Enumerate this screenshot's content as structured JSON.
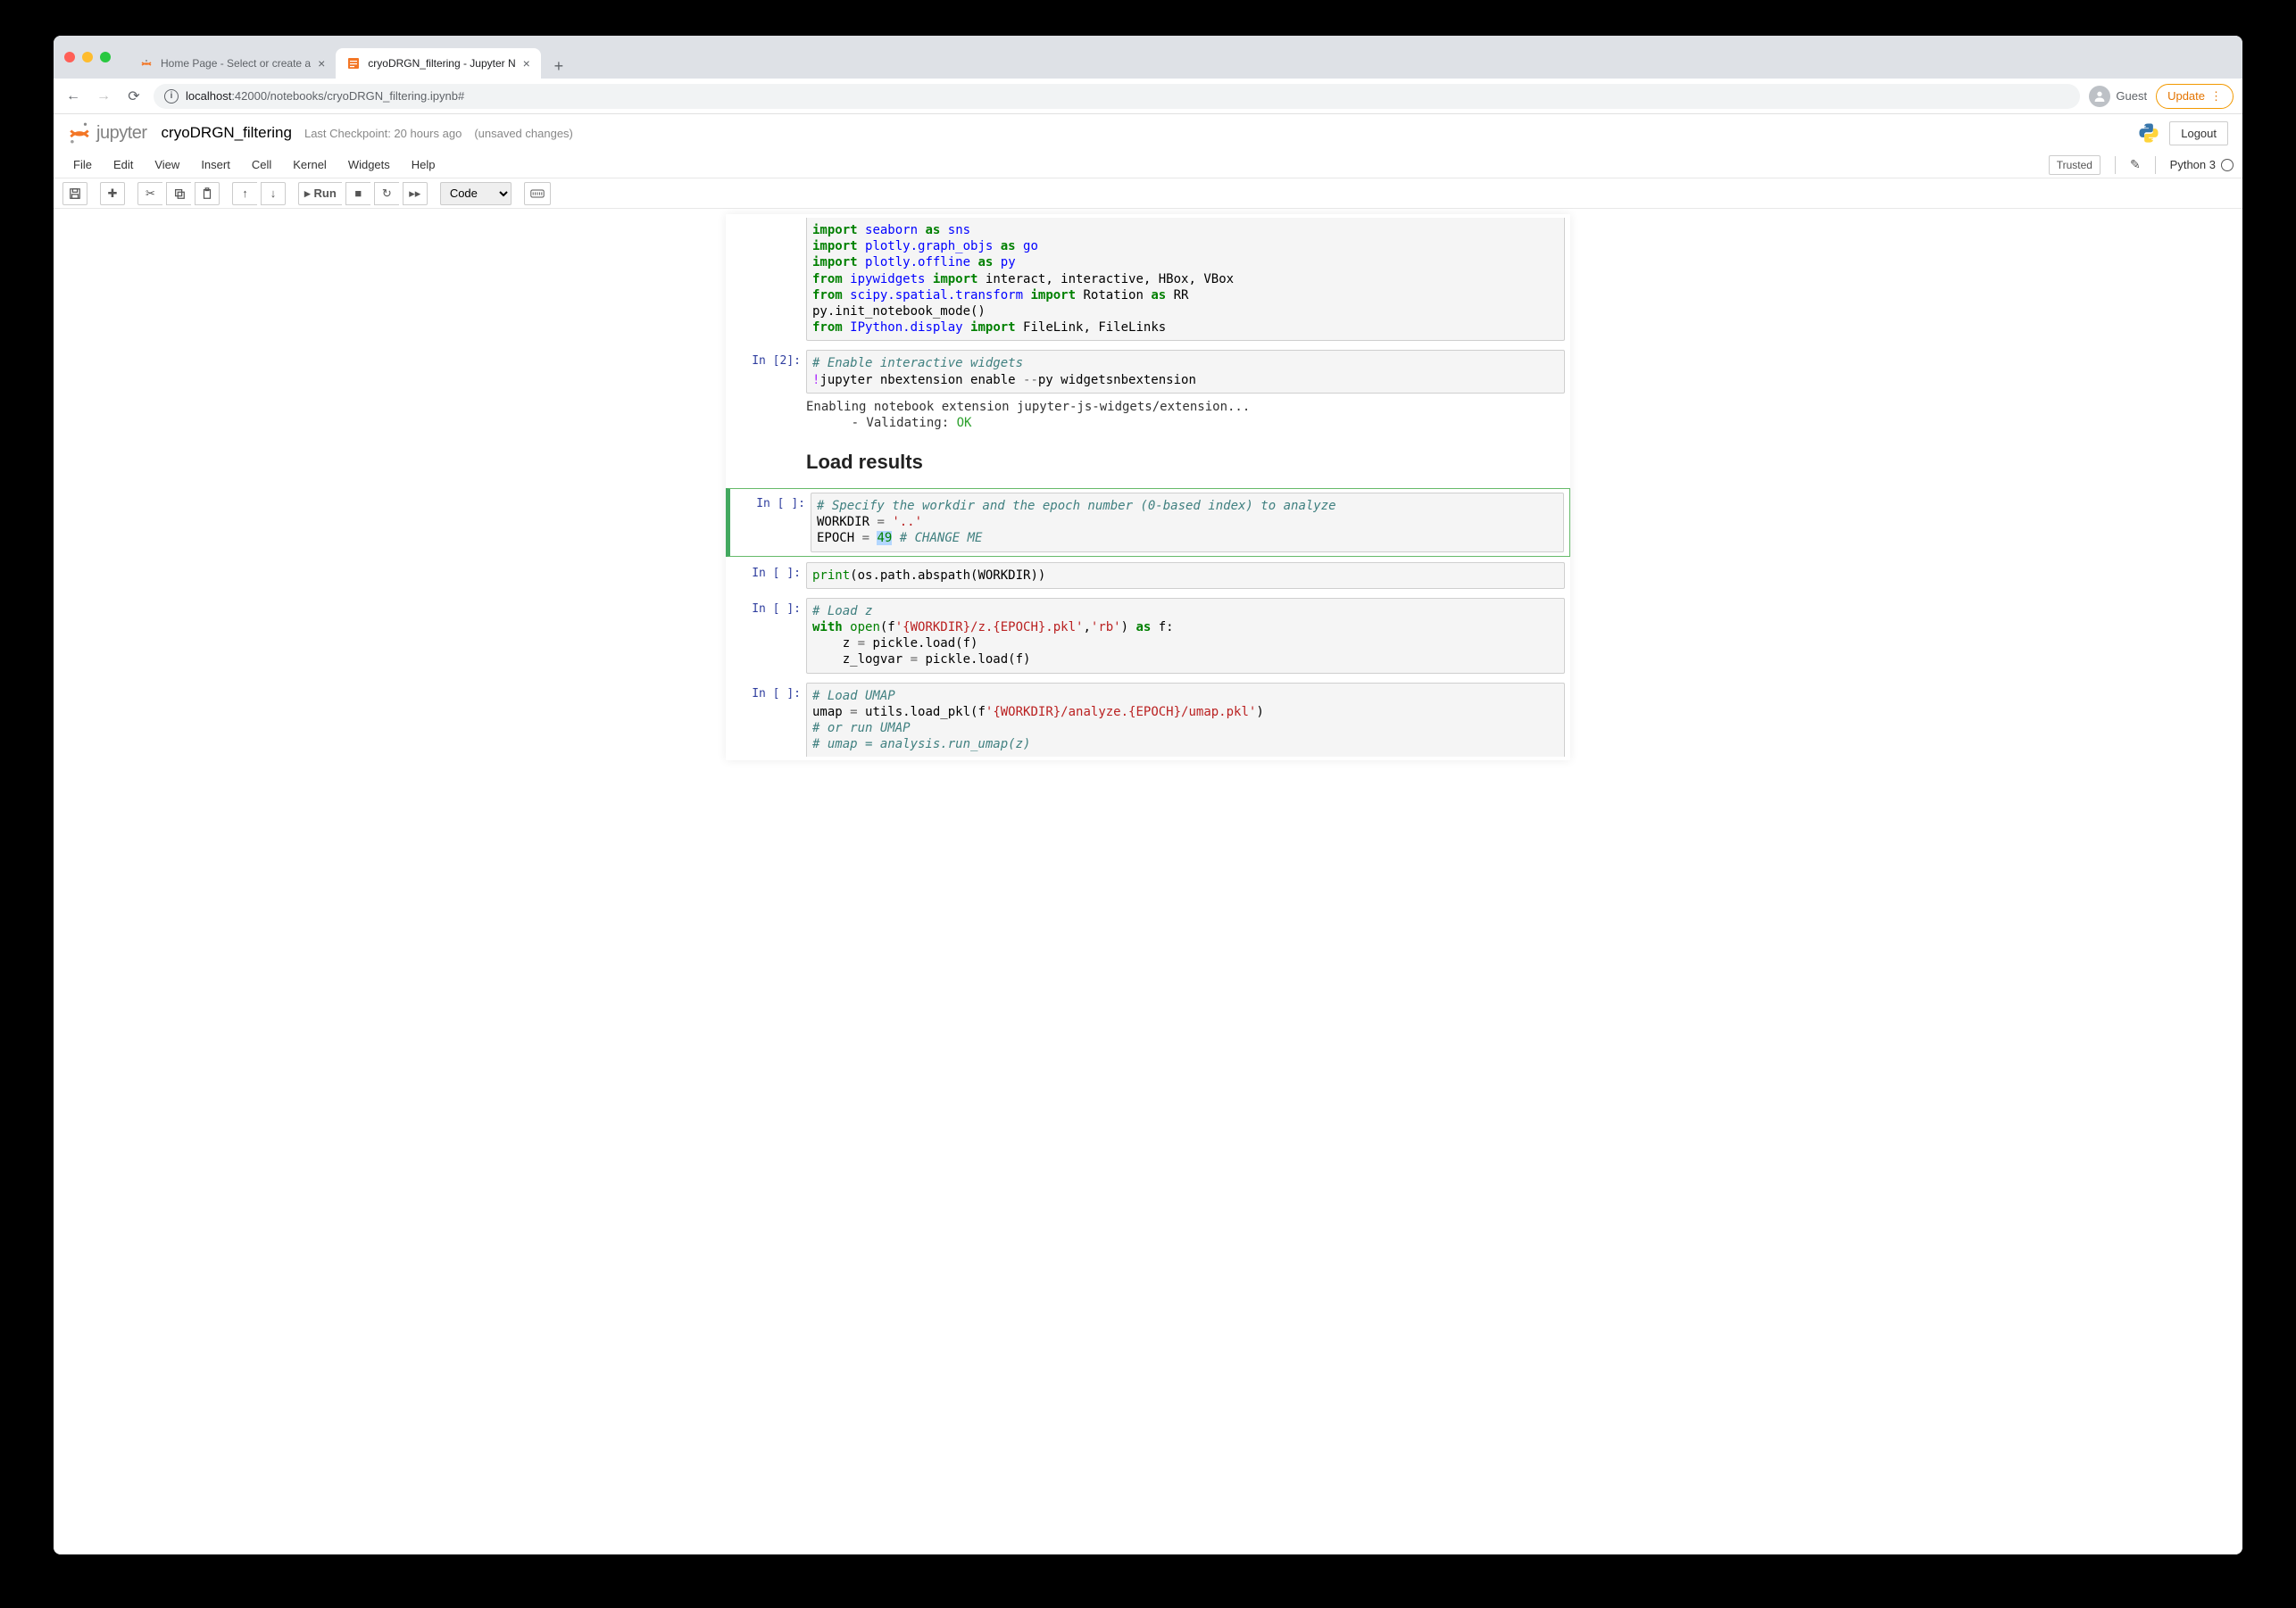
{
  "browser": {
    "tabs": [
      {
        "title": "Home Page - Select or create a",
        "active": false
      },
      {
        "title": "cryoDRGN_filtering - Jupyter N",
        "active": true
      }
    ],
    "url_prefix": "localhost",
    "url_rest": ":42000/notebooks/cryoDRGN_filtering.ipynb#",
    "guest": "Guest",
    "update": "Update"
  },
  "jupyter": {
    "logo_text": "jupyter",
    "notebook_name": "cryoDRGN_filtering",
    "checkpoint": "Last Checkpoint: 20 hours ago",
    "unsaved": "(unsaved changes)",
    "logout": "Logout",
    "menubar": [
      "File",
      "Edit",
      "View",
      "Insert",
      "Cell",
      "Kernel",
      "Widgets",
      "Help"
    ],
    "trusted": "Trusted",
    "kernel": "Python 3",
    "run_label": "Run",
    "cell_type_selected": "Code"
  },
  "cells": {
    "cell0_prompt": " ",
    "cell1_prompt": "In [2]:",
    "cell1_comment": "# Enable interactive widgets",
    "cell1_line2_pre": "jupyter nbextension enable ",
    "cell1_line2_flag": "--",
    "cell1_line2_rest": "py widgetsnbextension",
    "cell1_output_line1": "Enabling notebook extension jupyter-js-widgets/extension...",
    "cell1_output_line2_pre": "      - Validating: ",
    "cell1_output_ok": "OK",
    "heading": "Load results",
    "cell2_prompt": "In [ ]:",
    "cell2_comment": "# Specify the workdir and the epoch number (0-based index) to analyze",
    "cell2_line2_a": "WORKDIR ",
    "cell2_line2_op": "=",
    "cell2_line2_b": " ",
    "cell2_line2_str": "'..'",
    "cell2_line3_a": "EPOCH ",
    "cell2_line3_op": "=",
    "cell2_line3_b": " ",
    "cell2_line3_num": "49",
    "cell2_line3_c": " ",
    "cell2_line3_comment": "# CHANGE ME",
    "cell3_prompt": "In [ ]:",
    "cell4_prompt": "In [ ]:",
    "cell4_comment": "# Load z",
    "cell5_prompt": "In [ ]:",
    "cell5_comment": "# Load UMAP",
    "cell5_line3_comment": "# or run UMAP",
    "cell5_line4_comment": "# umap = analysis.run_umap(z)"
  }
}
